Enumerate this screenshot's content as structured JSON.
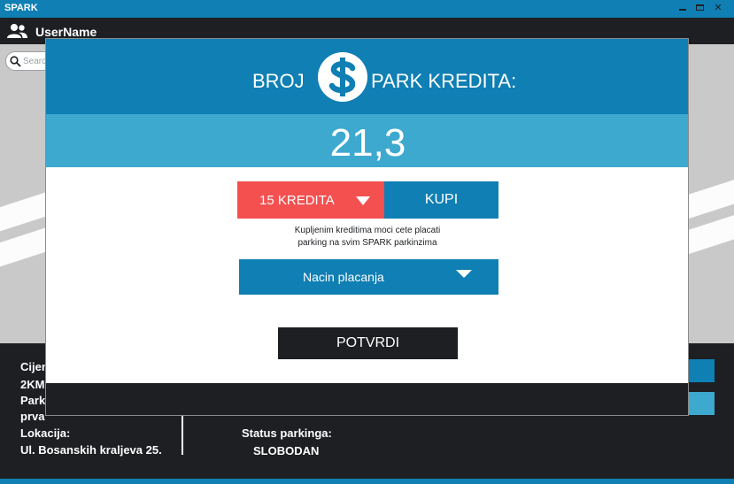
{
  "window": {
    "title": "SPARK",
    "controls": {
      "minimize_icon": "minimize-icon",
      "maximize_icon": "maximize-icon",
      "close_glyph": "✕"
    }
  },
  "header": {
    "user_icon": "users-icon",
    "username": "UserName"
  },
  "search": {
    "placeholder": "Search",
    "icon": "search-icon"
  },
  "info": {
    "price_label": "Cijena",
    "price_value": "2KM",
    "parking_label": "Parking",
    "parking_value": "prva",
    "location_label": "Lokacija:",
    "location_value": "Ul. Bosanskih kraljeva 25.",
    "status_label": "Status parkinga:",
    "status_value": "SLOBODAN"
  },
  "dialog": {
    "title_left": "BROJ",
    "title_icon": "dollar-coin-icon",
    "title_right": "PARK KREDITA:",
    "credit_value": "21,3",
    "amount_selected": "15 KREDITA",
    "buy_label": "KUPI",
    "note_line1": "Kupljenim kreditima moci cete placati",
    "note_line2": "parking na svim SPARK parkinzima",
    "payment_selected": "Nacin placanja",
    "confirm_label": "POTVRDI"
  },
  "colors": {
    "brand_blue": "#0f7fb4",
    "light_blue": "#3ea9cf",
    "dark": "#1d1f22",
    "accent_red": "#f45050"
  }
}
